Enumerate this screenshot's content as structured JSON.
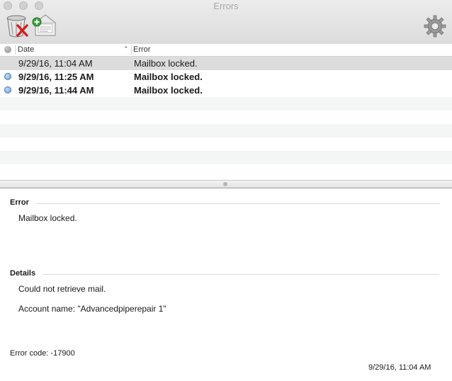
{
  "window": {
    "title": "Errors"
  },
  "table": {
    "columns": {
      "date": "Date",
      "error": "Error"
    },
    "rows": [
      {
        "date": "9/29/16, 11:04 AM",
        "error": "Mailbox locked.",
        "unread": false,
        "selected": true
      },
      {
        "date": "9/29/16, 11:25 AM",
        "error": "Mailbox locked.",
        "unread": true,
        "selected": false
      },
      {
        "date": "9/29/16, 11:44 AM",
        "error": "Mailbox locked.",
        "unread": true,
        "selected": false
      }
    ]
  },
  "detail": {
    "error_heading": "Error",
    "error_text": "Mailbox locked.",
    "details_heading": "Details",
    "details_line1": "Could not retrieve mail.",
    "details_line2": "Account name: \"Advancedpiperepair 1\"",
    "error_code": "Error code: -17900",
    "timestamp": "9/29/16, 11:04 AM"
  },
  "colors": {
    "unread_dot": "#6e9fd9",
    "selected_row": "#dcdcdc",
    "alt_row": "#f4f5f5"
  }
}
